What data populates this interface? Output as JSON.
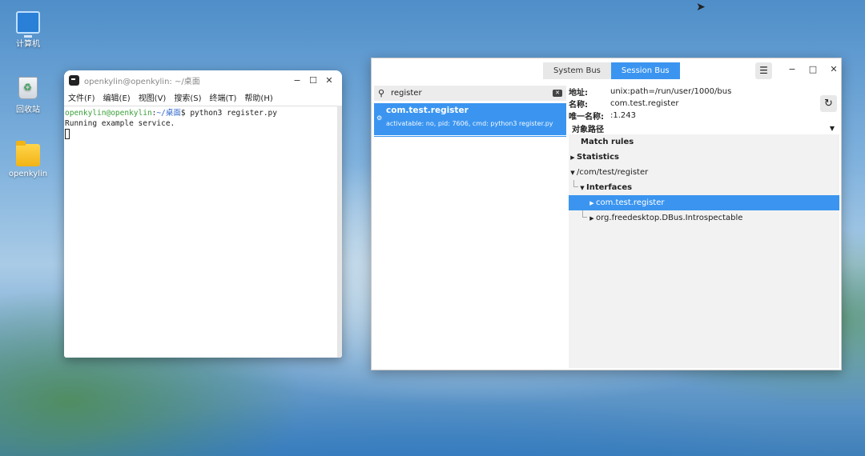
{
  "desktop": {
    "icons": [
      {
        "label": "计算机",
        "icon": "computer-icon"
      },
      {
        "label": "回收站",
        "icon": "trash-icon"
      },
      {
        "label": "openkylin",
        "icon": "folder-icon"
      }
    ]
  },
  "terminal": {
    "title": "openkylin@openkylin: ~/桌面",
    "window_buttons": {
      "minimize": "−",
      "maximize": "☐",
      "close": "✕"
    },
    "menu": [
      "文件(F)",
      "编辑(E)",
      "视图(V)",
      "搜索(S)",
      "终端(T)",
      "帮助(H)"
    ],
    "lines": {
      "prompt_user": "openkylin@openkylin",
      "prompt_sep": ":",
      "prompt_path": "~/桌面",
      "prompt_dollar": "$ ",
      "command": "python3 register.py",
      "output": "Running example service."
    }
  },
  "dbus_viewer": {
    "tabs": [
      "System Bus",
      "Session Bus"
    ],
    "active_tab": "Session Bus",
    "window_buttons": {
      "minimize": "−",
      "maximize": "□",
      "close": "✕"
    },
    "search": {
      "value": "register"
    },
    "services": [
      {
        "name": "com.test.register",
        "info": "activatable: no, pid: 7606, cmd: python3 register.py"
      }
    ],
    "details": {
      "address_label": "地址:",
      "address_value": "unix:path=/run/user/1000/bus",
      "name_label": "名称:",
      "name_value": "com.test.register",
      "unique_label": "唯一名称:",
      "unique_value": ":1.243",
      "object_path_label": "对象路径"
    },
    "tree": {
      "match_rules": "Match rules",
      "statistics": "Statistics",
      "object": "/com/test/register",
      "interfaces": "Interfaces",
      "iface_selected": "com.test.register",
      "iface_other": "org.freedesktop.DBus.Introspectable"
    }
  }
}
